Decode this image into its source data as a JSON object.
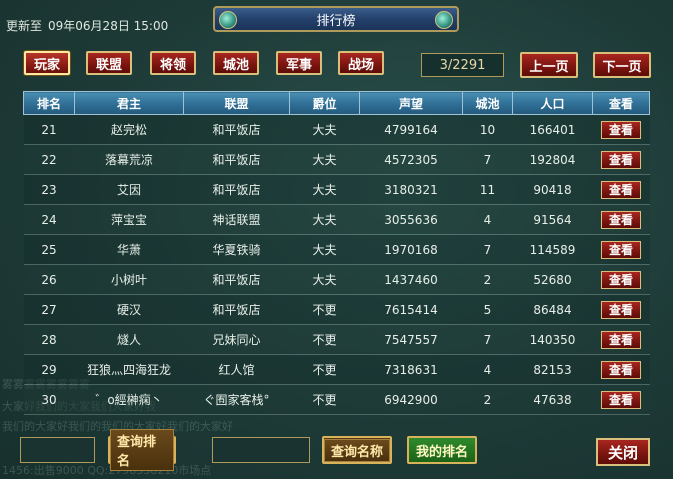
{
  "background_chat": [
    "雾雾雾雾雾雾雾雾",
    "大家好我们的大家我们大家好我",
    "我们的大家好我们的我们的大家好我们的大家好",
    "1456:出售9000 QQ:2798338210市场点"
  ],
  "update": {
    "label": "更新至",
    "value": "09年06月28日 15:00"
  },
  "title": "排行榜",
  "tabs": [
    {
      "label": "玩家",
      "active": true
    },
    {
      "label": "联盟",
      "active": false
    },
    {
      "label": "将领",
      "active": false
    },
    {
      "label": "城池",
      "active": false
    },
    {
      "label": "军事",
      "active": false
    },
    {
      "label": "战场",
      "active": false
    }
  ],
  "pagination": {
    "indicator": "3/2291",
    "prev_label": "上一页",
    "next_label": "下一页"
  },
  "table": {
    "columns": [
      "排名",
      "君主",
      "联盟",
      "爵位",
      "声望",
      "城池",
      "人口",
      "查看"
    ],
    "view_label": "查看",
    "rows": [
      {
        "rank": "21",
        "lord": "赵完松",
        "alliance": "和平饭店",
        "title": "大夫",
        "prestige": "4799164",
        "cities": "10",
        "population": "166401"
      },
      {
        "rank": "22",
        "lord": "落幕荒凉",
        "alliance": "和平饭店",
        "title": "大夫",
        "prestige": "4572305",
        "cities": "7",
        "population": "192804"
      },
      {
        "rank": "23",
        "lord": "艾因",
        "alliance": "和平饭店",
        "title": "大夫",
        "prestige": "3180321",
        "cities": "11",
        "population": "90418"
      },
      {
        "rank": "24",
        "lord": "萍宝宝",
        "alliance": "神话联盟",
        "title": "大夫",
        "prestige": "3055636",
        "cities": "4",
        "population": "91564"
      },
      {
        "rank": "25",
        "lord": "华萧",
        "alliance": "华夏铁骑",
        "title": "大夫",
        "prestige": "1970168",
        "cities": "7",
        "population": "114589"
      },
      {
        "rank": "26",
        "lord": "小树叶",
        "alliance": "和平饭店",
        "title": "大夫",
        "prestige": "1437460",
        "cities": "2",
        "population": "52680"
      },
      {
        "rank": "27",
        "lord": "硬汉",
        "alliance": "和平饭店",
        "title": "不更",
        "prestige": "7615414",
        "cities": "5",
        "population": "86484"
      },
      {
        "rank": "28",
        "lord": "燧人",
        "alliance": "兄妹同心",
        "title": "不更",
        "prestige": "7547557",
        "cities": "7",
        "population": "140350"
      },
      {
        "rank": "29",
        "lord": "狂狼灬四海狂龙",
        "alliance": "红人馆",
        "title": "不更",
        "prestige": "7318631",
        "cities": "4",
        "population": "82153"
      },
      {
        "rank": "30",
        "lord": "゛o經榊痫丶",
        "alliance": "ぐ囿家客栈°",
        "title": "不更",
        "prestige": "6942900",
        "cities": "2",
        "population": "47638"
      }
    ]
  },
  "search": {
    "rank_input_value": "",
    "rank_button_label": "查询排名",
    "name_input_value": "",
    "name_button_label": "查询名称",
    "my_rank_label": "我的排名"
  },
  "close_label": "关闭"
}
